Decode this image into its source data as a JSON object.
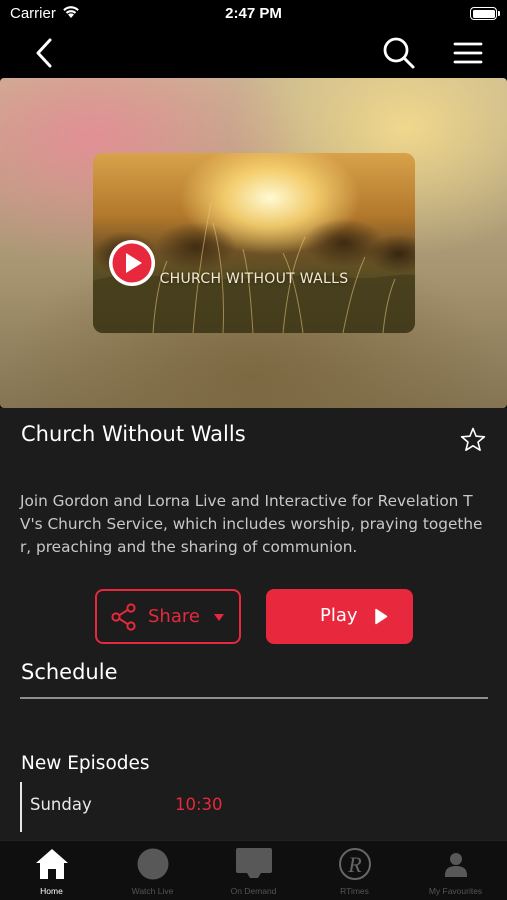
{
  "status_bar": {
    "carrier": "Carrier",
    "time": "2:47 PM"
  },
  "nav": {
    "back_icon": "chevron-left-icon",
    "search_icon": "search-icon",
    "menu_icon": "hamburger-menu-icon"
  },
  "hero": {
    "thumbnail_text": "CHURCH WITHOUT WALLS"
  },
  "show": {
    "title": "Church Without Walls",
    "description": "Join Gordon and Lorna Live and Interactive for Revelation TV's Church Service, which includes worship, praying together, preaching and the sharing of communion."
  },
  "actions": {
    "share_label": "Share",
    "play_label": "Play"
  },
  "schedule": {
    "heading": "Schedule",
    "episodes_heading": "New Episodes",
    "episodes": [
      {
        "day": "Sunday",
        "time": "10:30"
      }
    ]
  },
  "tabs": [
    {
      "label": "Home",
      "icon": "home-icon",
      "active": true
    },
    {
      "label": "Watch Live",
      "icon": "circle-icon",
      "active": false
    },
    {
      "label": "On Demand",
      "icon": "tv-icon",
      "active": false
    },
    {
      "label": "RTimes",
      "icon": "rtimes-logo-icon",
      "active": false
    },
    {
      "label": "My Favourites",
      "icon": "user-icon",
      "active": false
    }
  ],
  "colors": {
    "accent": "#e8283c",
    "background": "#1c1c1c"
  }
}
